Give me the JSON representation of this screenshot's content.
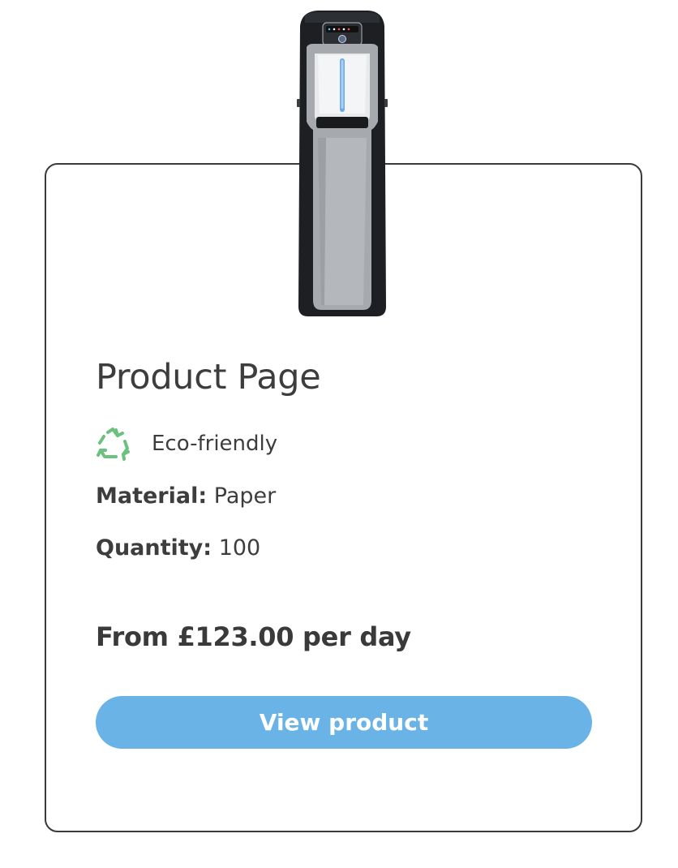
{
  "product": {
    "title": "Product Page",
    "image_icon": "water-cooler-image",
    "badge": {
      "icon": "recycle-icon",
      "label": "Eco-friendly",
      "color": "#6cc17e"
    },
    "specs": {
      "material_key": "Material:",
      "material_value": "Paper",
      "quantity_key": "Quantity:",
      "quantity_value": "100"
    },
    "price_text": "From £123.00 per day",
    "cta_label": "View product",
    "cta_color": "#69b3e6"
  }
}
